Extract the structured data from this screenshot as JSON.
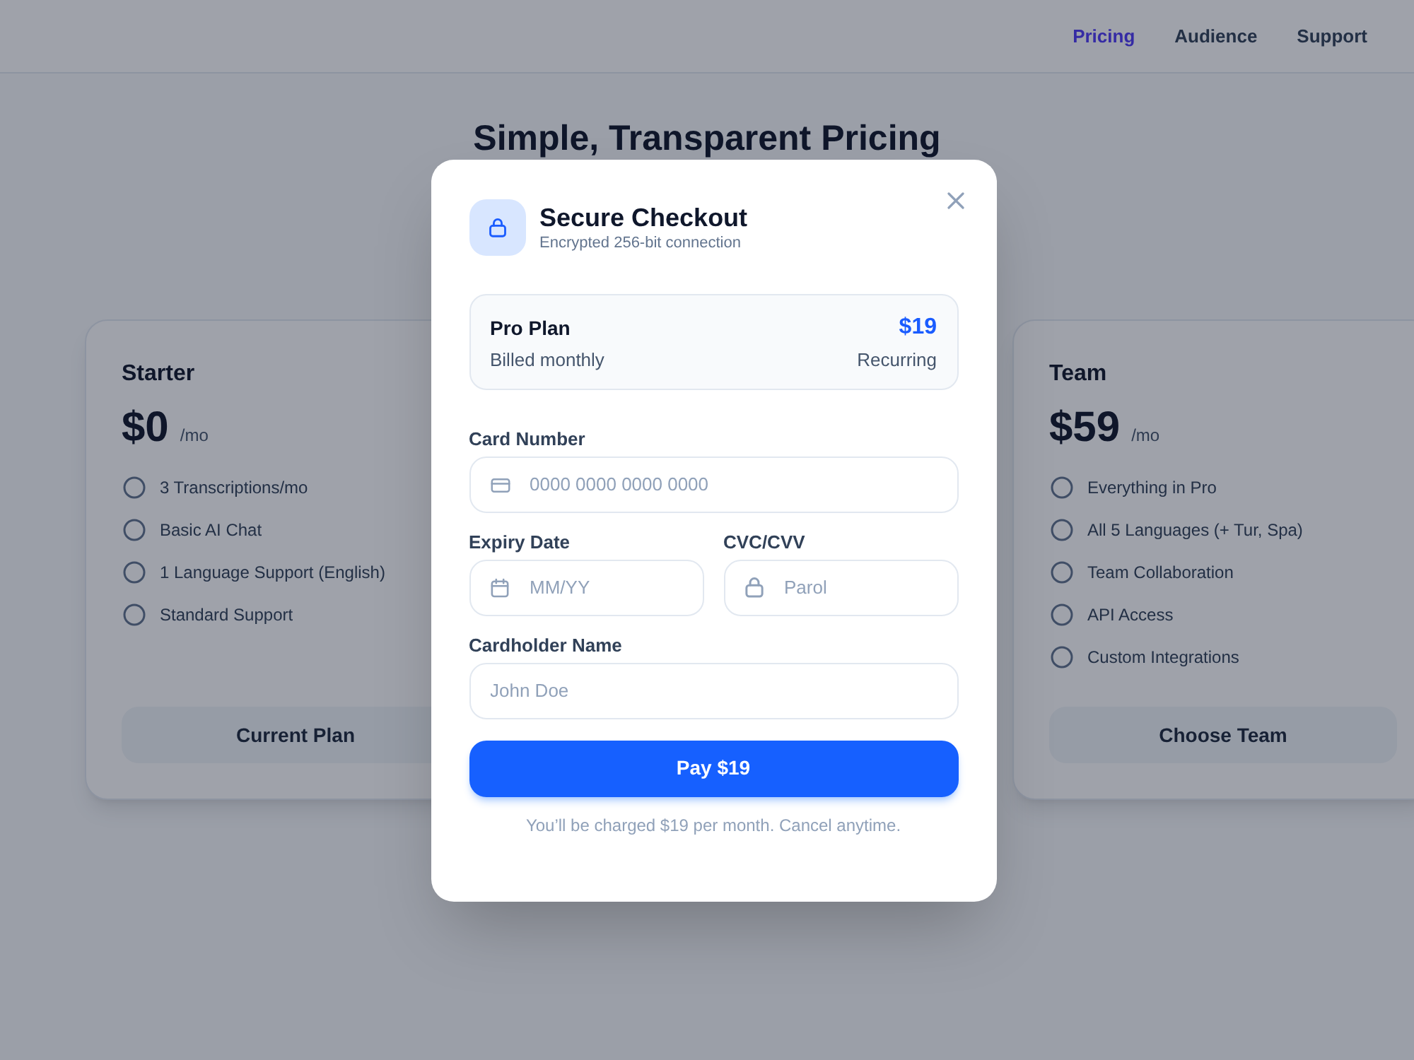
{
  "nav": {
    "links": [
      {
        "label": "Pricing",
        "selected": true
      },
      {
        "label": "Audience",
        "selected": false
      },
      {
        "label": "Support",
        "selected": false
      }
    ]
  },
  "hero": {
    "title": "Simple, Transparent Pricing"
  },
  "plans": [
    {
      "name": "Starter",
      "price": "$0",
      "period": "/mo",
      "features": [
        "3 Transcriptions/mo",
        "Basic AI Chat",
        "1 Language Support (English)",
        "Standard Support"
      ],
      "button": "Current Plan"
    },
    {
      "name": "Team",
      "price": "$59",
      "period": "/mo",
      "features": [
        "Everything in Pro",
        "All 5 Languages (+ Tur, Spa)",
        "Team Collaboration",
        "API Access",
        "Custom Integrations"
      ],
      "button": "Choose Team"
    }
  ],
  "modal": {
    "title": "Secure Checkout",
    "subtitle": "Encrypted 256-bit connection",
    "summary": {
      "plan": "Pro Plan",
      "price": "$19",
      "billing": "Billed monthly",
      "type": "Recurring"
    },
    "card_number": {
      "label": "Card Number",
      "placeholder": "0000 0000 0000 0000"
    },
    "expiry": {
      "label": "Expiry Date",
      "placeholder": "MM/YY"
    },
    "cvc": {
      "label": "CVC/CVV",
      "placeholder": "Parol"
    },
    "cardholder": {
      "label": "Cardholder Name",
      "placeholder": "John Doe"
    },
    "pay_button": "Pay $19",
    "note": "You’ll be charged $19 per month. Cancel anytime."
  }
}
